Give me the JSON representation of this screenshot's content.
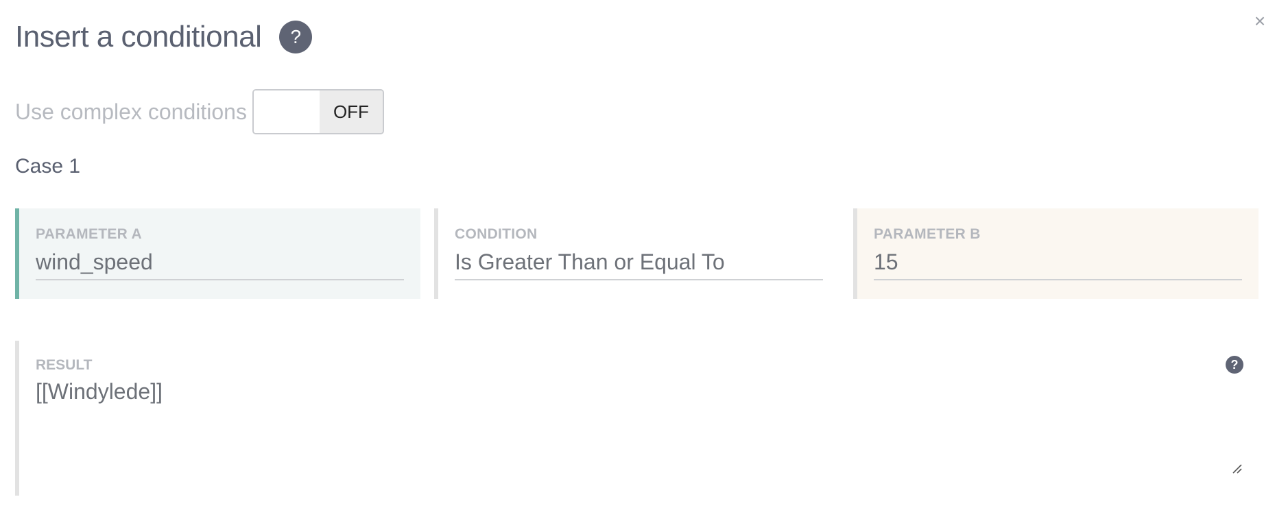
{
  "dialog": {
    "title": "Insert a conditional",
    "help_glyph": "?",
    "close_glyph": "×",
    "close_icon": "close-icon",
    "help_icon": "question-circle-icon"
  },
  "toggle": {
    "label": "Use complex conditions",
    "state": "OFF"
  },
  "case": {
    "title": "Case 1",
    "parameter_a": {
      "label": "PARAMETER A",
      "value": "wind_speed"
    },
    "condition": {
      "label": "CONDITION",
      "value": "Is Greater Than or Equal To"
    },
    "parameter_b": {
      "label": "PARAMETER B",
      "value": "15"
    },
    "result": {
      "label": "RESULT",
      "value": "[[Windylede]]",
      "help_glyph": "?",
      "help_icon": "question-circle-icon"
    }
  },
  "colors": {
    "parameter_a_accent": "#6fb3a6",
    "parameter_a_bg": "#f2f6f6",
    "parameter_b_bg": "#fbf7f1",
    "help_bg": "#5f6474"
  }
}
